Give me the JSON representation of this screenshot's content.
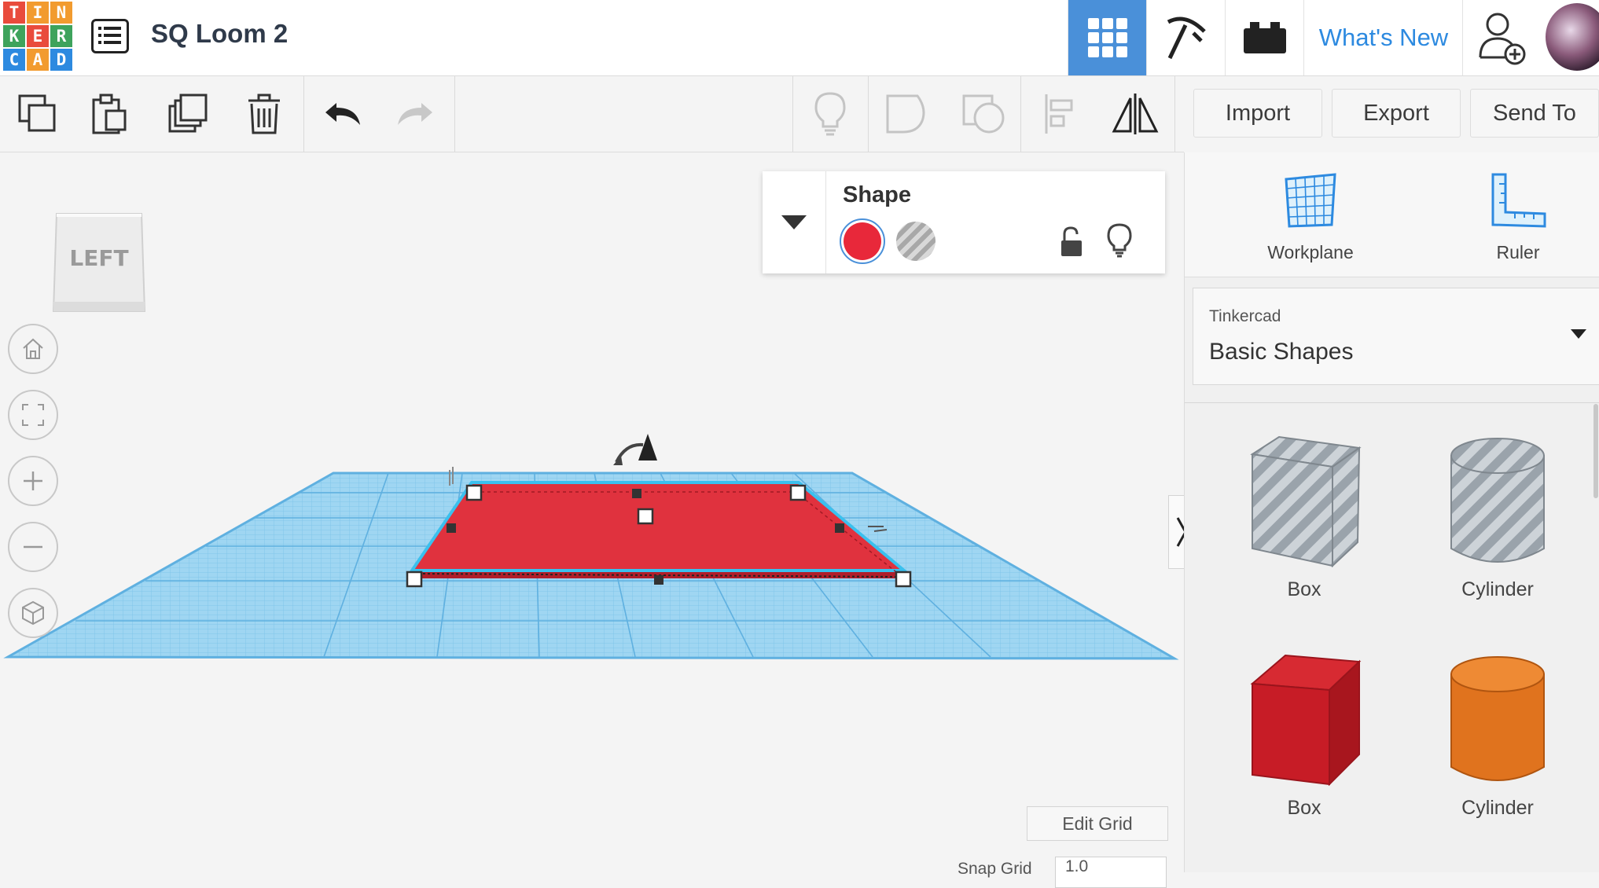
{
  "app": {
    "logo_letters": [
      "T",
      "I",
      "N",
      "K",
      "E",
      "R",
      "C",
      "A",
      "D"
    ],
    "logo_colors": [
      "#e94b3c",
      "#f29b2f",
      "#f29b2f",
      "#3ea35c",
      "#e94b3c",
      "#3ea35c",
      "#2d8ae0",
      "#f29b2f",
      "#2d8ae0"
    ],
    "design_title": "SQ Loom 2"
  },
  "topnav": {
    "whats_new": "What's New",
    "active_color": "#4a90d9"
  },
  "toolbar": {
    "import_label": "Import",
    "export_label": "Export",
    "send_to_label": "Send To"
  },
  "viewcube": {
    "face_label": "LEFT"
  },
  "shape_panel": {
    "title": "Shape",
    "solid_color": "#e8283a"
  },
  "workspace": {
    "edit_grid_label": "Edit Grid",
    "snap_grid_label": "Snap Grid",
    "snap_grid_value": "1.0"
  },
  "right_panel": {
    "workplane_label": "Workplane",
    "ruler_label": "Ruler",
    "library_provider": "Tinkercad",
    "library_name": "Basic Shapes",
    "shapes": [
      {
        "label": "Box",
        "kind": "box-hole"
      },
      {
        "label": "Cylinder",
        "kind": "cylinder-hole"
      },
      {
        "label": "Box",
        "kind": "box-solid"
      },
      {
        "label": "Cylinder",
        "kind": "cylinder-solid"
      }
    ]
  }
}
